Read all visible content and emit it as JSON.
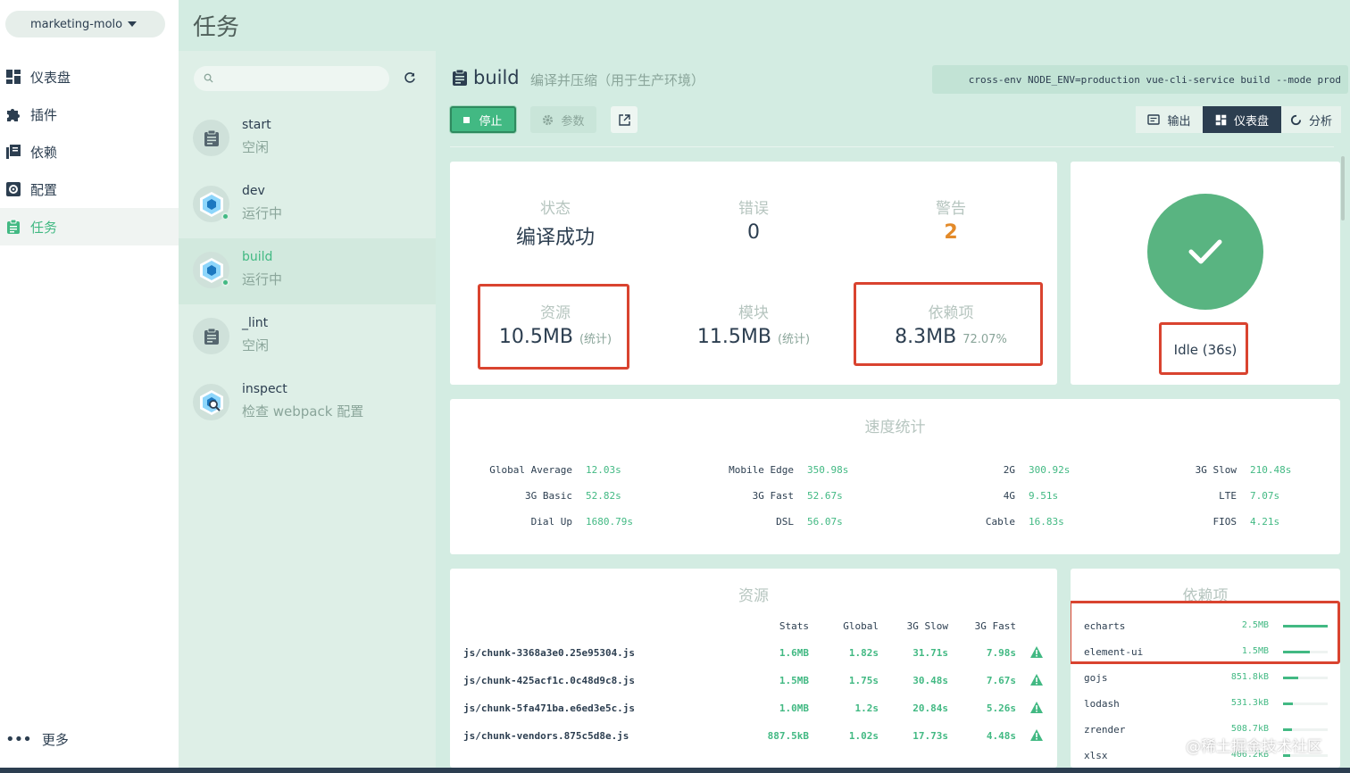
{
  "sidebar": {
    "project": "marketing-molo",
    "items": [
      {
        "label": "仪表盘",
        "icon": "dashboard-icon"
      },
      {
        "label": "插件",
        "icon": "puzzle-icon"
      },
      {
        "label": "依赖",
        "icon": "library-icon"
      },
      {
        "label": "配置",
        "icon": "settings-icon"
      },
      {
        "label": "任务",
        "icon": "assignment-icon"
      }
    ],
    "active_index": 4,
    "more_label": "更多"
  },
  "header": {
    "title": "任务"
  },
  "tasks": [
    {
      "name": "start",
      "status": "空闲",
      "icon": "clipboard-icon",
      "running": false
    },
    {
      "name": "dev",
      "status": "运行中",
      "icon": "webpack-icon",
      "running": true
    },
    {
      "name": "build",
      "status": "运行中",
      "icon": "webpack-icon",
      "running": true,
      "active": true
    },
    {
      "name": "_lint",
      "status": "空闲",
      "icon": "clipboard-icon",
      "running": false
    },
    {
      "name": "inspect",
      "status": "检查 webpack 配置",
      "icon": "webpack-inspect-icon",
      "running": false
    }
  ],
  "task_detail": {
    "name": "build",
    "description": "编译并压缩（用于生产环境）",
    "command": "cross-env NODE_ENV=production vue-cli-service build --mode prod",
    "stop_label": "停止",
    "params_label": "参数",
    "tabs": [
      {
        "label": "输出",
        "icon": "terminal-icon"
      },
      {
        "label": "仪表盘",
        "icon": "dashboard-icon",
        "active": true
      },
      {
        "label": "分析",
        "icon": "donut-icon"
      }
    ]
  },
  "status_card": {
    "status_label": "状态",
    "status_value": "编译成功",
    "errors_label": "错误",
    "errors_value": "0",
    "warnings_label": "警告",
    "warnings_value": "2",
    "assets_label": "资源",
    "assets_value": "10.5MB",
    "assets_note": "(统计)",
    "modules_label": "模块",
    "modules_value": "11.5MB",
    "modules_note": "(统计)",
    "deps_label": "依赖项",
    "deps_value": "8.3MB",
    "deps_note": "72.07%"
  },
  "idle_card": {
    "text": "Idle (36s)"
  },
  "speed": {
    "title": "速度统计",
    "rows": [
      [
        {
          "k": "Global Average",
          "v": "12.03s"
        },
        {
          "k": "Mobile Edge",
          "v": "350.98s"
        },
        {
          "k": "2G",
          "v": "300.92s"
        },
        {
          "k": "3G Slow",
          "v": "210.48s"
        }
      ],
      [
        {
          "k": "3G Basic",
          "v": "52.82s"
        },
        {
          "k": "3G Fast",
          "v": "52.67s"
        },
        {
          "k": "4G",
          "v": "9.51s"
        },
        {
          "k": "LTE",
          "v": "7.07s"
        }
      ],
      [
        {
          "k": "Dial Up",
          "v": "1680.79s"
        },
        {
          "k": "DSL",
          "v": "56.07s"
        },
        {
          "k": "Cable",
          "v": "16.83s"
        },
        {
          "k": "FIOS",
          "v": "4.21s"
        }
      ]
    ]
  },
  "assets": {
    "title": "资源",
    "headers": [
      "Stats",
      "Global",
      "3G Slow",
      "3G Fast"
    ],
    "rows": [
      {
        "file": "js/chunk-3368a3e0.25e95304.js",
        "stats": "1.6MB",
        "global": "1.82s",
        "slow": "31.71s",
        "fast": "7.98s"
      },
      {
        "file": "js/chunk-425acf1c.0c48d9c8.js",
        "stats": "1.5MB",
        "global": "1.75s",
        "slow": "30.48s",
        "fast": "7.67s"
      },
      {
        "file": "js/chunk-5fa471ba.e6ed3e5c.js",
        "stats": "1.0MB",
        "global": "1.2s",
        "slow": "20.84s",
        "fast": "5.26s"
      },
      {
        "file": "js/chunk-vendors.875c5d8e.js",
        "stats": "887.5kB",
        "global": "1.02s",
        "slow": "17.73s",
        "fast": "4.48s"
      }
    ]
  },
  "deps": {
    "title": "依赖项",
    "rows": [
      {
        "name": "echarts",
        "size": "2.5MB",
        "fraction": 1.0
      },
      {
        "name": "element-ui",
        "size": "1.5MB",
        "fraction": 0.6
      },
      {
        "name": "gojs",
        "size": "851.8kB",
        "fraction": 0.34
      },
      {
        "name": "lodash",
        "size": "531.3kB",
        "fraction": 0.21
      },
      {
        "name": "zrender",
        "size": "508.7kB",
        "fraction": 0.2
      },
      {
        "name": "xlsx",
        "size": "406.2kB",
        "fraction": 0.16
      }
    ]
  },
  "watermark": "@稀土掘金技术社区",
  "colors": {
    "accent": "#42b983",
    "dark": "#2c3e50",
    "highlight": "#d9432f",
    "warning": "#e38a29"
  }
}
